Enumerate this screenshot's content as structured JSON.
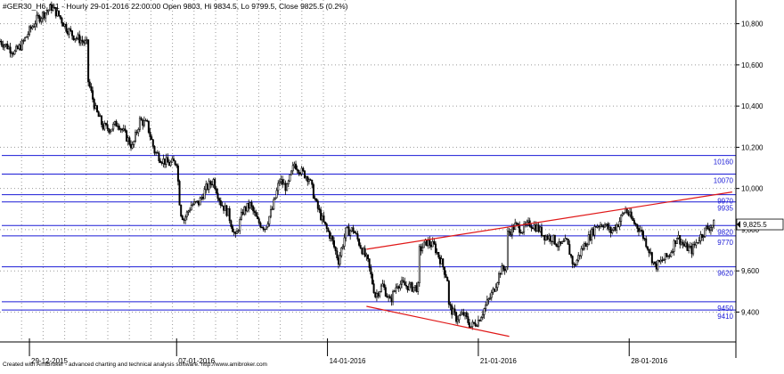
{
  "chart_data": {
    "type": "candlestick",
    "header": "#GER30_H6_H1 - Hourly 29-01-2016 22:00:00 Open 9803, Hi 9834.5, Lo 9799.5, Close 9825.5 (0.2%)",
    "footer": "Created with AmiBroker - advanced charting and technical analysis software. http://www.amibroker.com",
    "ylim": [
      9255,
      10915
    ],
    "xlim": [
      0,
      100
    ],
    "grid": true,
    "y_ticks": [
      {
        "value": 10800,
        "label": "10,800"
      },
      {
        "value": 10600,
        "label": "10,600"
      },
      {
        "value": 10400,
        "label": "10,400"
      },
      {
        "value": 10200,
        "label": "10,200"
      },
      {
        "value": 10000,
        "label": "10,000"
      },
      {
        "value": 9800,
        "label": "9,800"
      },
      {
        "value": 9600,
        "label": "9,600"
      },
      {
        "value": 9400,
        "label": "9,400"
      }
    ],
    "x_ticks": [
      {
        "x": 4.0,
        "label": "29-12-2015"
      },
      {
        "x": 24.0,
        "label": "07-01-2016"
      },
      {
        "x": 44.5,
        "label": "14-01-2016"
      },
      {
        "x": 65.0,
        "label": "21-01-2016"
      },
      {
        "x": 85.5,
        "label": "28-01-2016"
      }
    ],
    "levels": [
      {
        "value": 10160,
        "label": "10160"
      },
      {
        "value": 10070,
        "label": "10070"
      },
      {
        "value": 9970,
        "label": "9970"
      },
      {
        "value": 9935,
        "label": "9935"
      },
      {
        "value": 9820,
        "label": "9820"
      },
      {
        "value": 9770,
        "label": "9770"
      },
      {
        "value": 9620,
        "label": "9620"
      },
      {
        "value": 9450,
        "label": "9450"
      },
      {
        "value": 9410,
        "label": "9410"
      }
    ],
    "trendlines": [
      {
        "x1": 49.8,
        "y1": 9705,
        "x2": 99.5,
        "y2": 9983
      },
      {
        "x1": 49.8,
        "y1": 9428,
        "x2": 69.2,
        "y2": 9282
      }
    ],
    "last_price": {
      "value": 9825.5,
      "label": "9,825.5"
    },
    "price_path": [
      [
        0.0,
        10715
      ],
      [
        1.0,
        10690
      ],
      [
        2.0,
        10660
      ],
      [
        3.0,
        10700
      ],
      [
        4.0,
        10765
      ],
      [
        5.0,
        10820
      ],
      [
        6.0,
        10850
      ],
      [
        7.0,
        10880
      ],
      [
        8.0,
        10840
      ],
      [
        9.0,
        10780
      ],
      [
        10.0,
        10740
      ],
      [
        11.0,
        10720
      ],
      [
        11.8,
        10700
      ],
      [
        12.0,
        10520
      ],
      [
        13.0,
        10380
      ],
      [
        14.0,
        10300
      ],
      [
        15.0,
        10290
      ],
      [
        16.0,
        10320
      ],
      [
        17.0,
        10260
      ],
      [
        18.0,
        10200
      ],
      [
        19.0,
        10330
      ],
      [
        20.0,
        10310
      ],
      [
        21.0,
        10180
      ],
      [
        22.0,
        10140
      ],
      [
        23.0,
        10120
      ],
      [
        24.0,
        10130
      ],
      [
        24.5,
        9890
      ],
      [
        25.0,
        9850
      ],
      [
        26.0,
        9920
      ],
      [
        27.0,
        9930
      ],
      [
        28.0,
        10000
      ],
      [
        29.0,
        10040
      ],
      [
        30.0,
        9930
      ],
      [
        31.0,
        9880
      ],
      [
        32.0,
        9760
      ],
      [
        33.0,
        9890
      ],
      [
        34.0,
        9920
      ],
      [
        35.0,
        9840
      ],
      [
        36.0,
        9810
      ],
      [
        37.0,
        9900
      ],
      [
        38.0,
        10040
      ],
      [
        39.0,
        10000
      ],
      [
        40.0,
        10120
      ],
      [
        41.0,
        10080
      ],
      [
        42.0,
        10050
      ],
      [
        43.0,
        9920
      ],
      [
        44.0,
        9830
      ],
      [
        45.0,
        9760
      ],
      [
        46.0,
        9650
      ],
      [
        47.0,
        9790
      ],
      [
        48.0,
        9800
      ],
      [
        49.0,
        9720
      ],
      [
        50.0,
        9640
      ],
      [
        51.0,
        9480
      ],
      [
        52.0,
        9530
      ],
      [
        53.0,
        9450
      ],
      [
        54.0,
        9540
      ],
      [
        55.0,
        9530
      ],
      [
        56.0,
        9520
      ],
      [
        56.8,
        9520
      ],
      [
        57.0,
        9700
      ],
      [
        58.0,
        9740
      ],
      [
        59.0,
        9720
      ],
      [
        60.0,
        9640
      ],
      [
        60.8,
        9560
      ],
      [
        61.0,
        9430
      ],
      [
        62.0,
        9370
      ],
      [
        63.0,
        9390
      ],
      [
        64.0,
        9330
      ],
      [
        65.0,
        9360
      ],
      [
        66.0,
        9430
      ],
      [
        67.0,
        9500
      ],
      [
        68.0,
        9600
      ],
      [
        68.8,
        9620
      ],
      [
        69.0,
        9780
      ],
      [
        70.0,
        9820
      ],
      [
        71.0,
        9800
      ],
      [
        72.0,
        9830
      ],
      [
        73.0,
        9810
      ],
      [
        74.0,
        9770
      ],
      [
        75.0,
        9760
      ],
      [
        76.0,
        9720
      ],
      [
        77.0,
        9740
      ],
      [
        78.0,
        9620
      ],
      [
        79.0,
        9700
      ],
      [
        80.0,
        9760
      ],
      [
        81.0,
        9820
      ],
      [
        82.0,
        9830
      ],
      [
        83.0,
        9790
      ],
      [
        84.0,
        9830
      ],
      [
        85.0,
        9900
      ],
      [
        86.0,
        9840
      ],
      [
        87.0,
        9800
      ],
      [
        88.0,
        9720
      ],
      [
        89.0,
        9620
      ],
      [
        90.0,
        9650
      ],
      [
        91.0,
        9680
      ],
      [
        92.0,
        9770
      ],
      [
        93.0,
        9720
      ],
      [
        94.0,
        9700
      ],
      [
        95.0,
        9760
      ],
      [
        96.0,
        9805
      ],
      [
        97.0,
        9826
      ]
    ]
  }
}
